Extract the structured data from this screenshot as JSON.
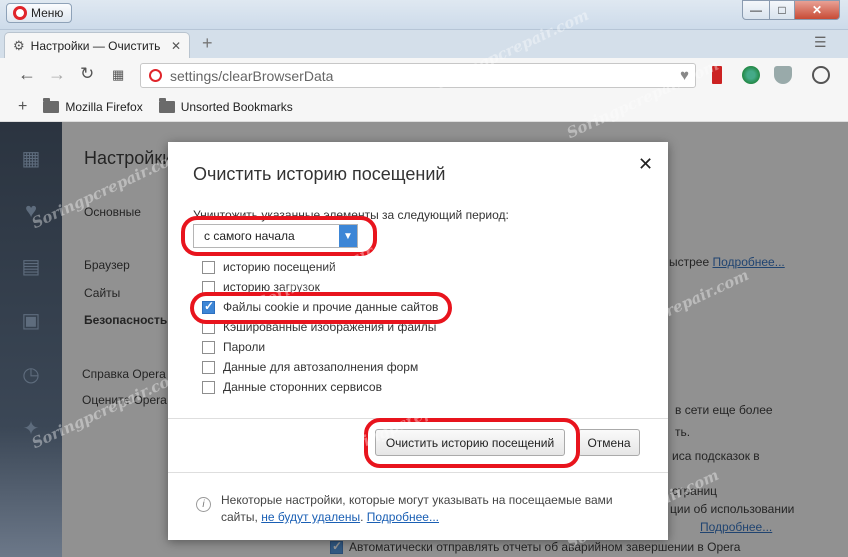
{
  "titlebar": {
    "menu_label": "Меню"
  },
  "tab": {
    "title": "Настройки — Очистить"
  },
  "address": {
    "url": "settings/clearBrowserData"
  },
  "bookmarks": [
    "Mozilla Firefox",
    "Unsorted Bookmarks"
  ],
  "page": {
    "title": "Настройки",
    "nav": [
      "Основные",
      "Браузер",
      "Сайты",
      "Безопасность",
      "Справка Opera",
      "Оцените Opera"
    ],
    "frag1": "ыстрее",
    "frag1_link": "Подробнее...",
    "frag2": "в сети еще более",
    "frag3": "ть.",
    "frag4": "иса подсказок в",
    "frag5": "страниц",
    "frag6": "ции об использовании",
    "frag6_link": "Подробнее...",
    "footer_checkbox": "Автоматически отправлять отчеты об аварийном завершении в Opera"
  },
  "dialog": {
    "title": "Очистить историю посещений",
    "period_label": "Уничтожить указанные элементы за следующий период:",
    "period_value": "с самого начала",
    "options": [
      {
        "label": "историю посещений",
        "checked": false
      },
      {
        "label": "историю загрузок",
        "checked": false
      },
      {
        "label": "Файлы cookie и прочие данные сайтов",
        "checked": true
      },
      {
        "label": "Кэшированные изображения и файлы",
        "checked": false
      },
      {
        "label": "Пароли",
        "checked": false
      },
      {
        "label": "Данные для автозаполнения форм",
        "checked": false
      },
      {
        "label": "Данные сторонних сервисов",
        "checked": false
      }
    ],
    "clear_button": "Очистить историю посещений",
    "cancel_button": "Отмена",
    "info_text": "Некоторые настройки, которые могут указывать на посещаемые вами сайты,",
    "info_link1": "не будут удалены",
    "info_link2": "Подробнее..."
  },
  "watermark": "Soringpcrepair.com"
}
